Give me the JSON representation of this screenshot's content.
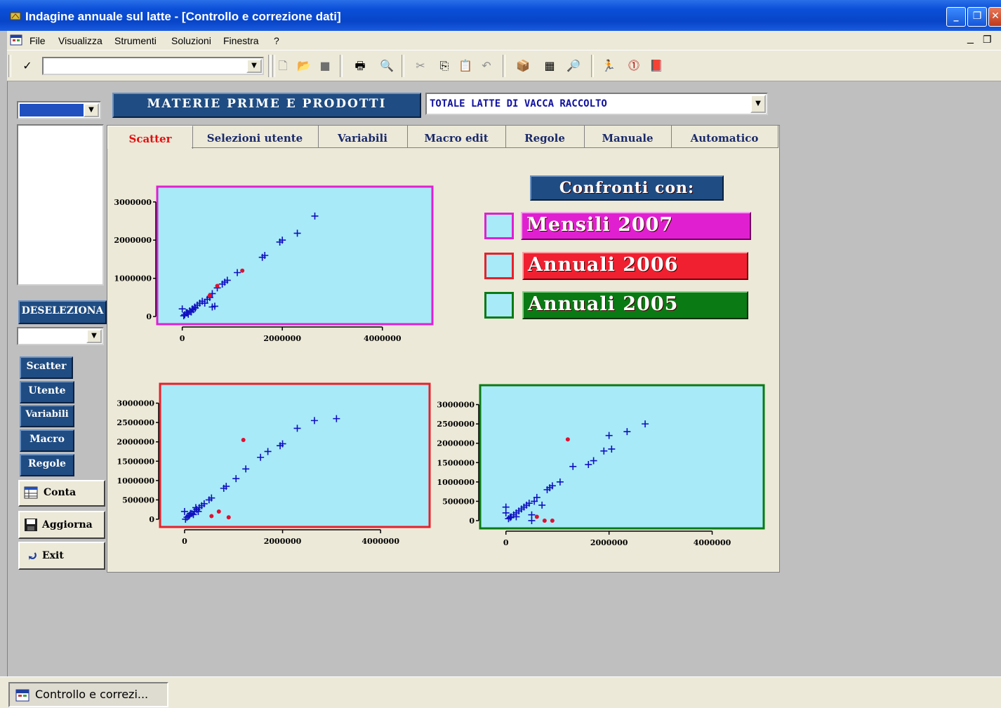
{
  "window": {
    "title": "Indagine annuale sul latte - [Controllo e correzione dati]"
  },
  "menu": [
    "File",
    "Visualizza",
    "Strumenti",
    "Soluzioni",
    "Finestra",
    "?"
  ],
  "header": {
    "section_label": "MATERIE PRIME E PRODOTTI",
    "variable_select": "TOTALE LATTE DI VACCA RACCOLTO"
  },
  "tabs": [
    "Scatter",
    "Selezioni utente",
    "Variabili",
    "Macro edit",
    "Regole",
    "Manuale",
    "Automatico"
  ],
  "left_panel": {
    "deselect_label": "DESELEZIONA",
    "nav_buttons": [
      "Scatter",
      "Utente",
      "Variabili",
      "Macro",
      "Regole"
    ],
    "conta_label": "Conta",
    "aggiorna_label": "Aggiorna",
    "exit_label": "Exit"
  },
  "legend": {
    "title": "Confronti con:",
    "items": [
      {
        "label": "Mensili 2007",
        "color": "#e020d0"
      },
      {
        "label": "Annuali 2006",
        "color": "#e8202a"
      },
      {
        "label": "Annuali 2005",
        "color": "#0a7a14"
      }
    ]
  },
  "taskbar": {
    "item": "Controllo e correzi..."
  },
  "colors": {
    "plot_bg": "#a8eaf8",
    "points": "#1010c0",
    "outliers": "#e01030"
  },
  "chart_data": [
    {
      "type": "scatter",
      "comparison": "Mensili 2007",
      "border_color": "#e020d0",
      "xlim": [
        -500000,
        5000000
      ],
      "ylim": [
        -200000,
        3400000
      ],
      "x_ticks": [
        0,
        2000000,
        4000000
      ],
      "y_ticks": [
        0,
        1000000,
        2000000,
        3000000
      ],
      "x_tick_labels": [
        "0",
        "2000000",
        "4000000"
      ],
      "y_tick_labels": [
        "0",
        "1000000",
        "2000000",
        "3000000"
      ],
      "series": [
        {
          "marker": "cross",
          "color": "#1010c0",
          "points": [
            [
              2650000,
              2630000
            ],
            [
              2300000,
              2180000
            ],
            [
              2000000,
              2000000
            ],
            [
              1950000,
              1950000
            ],
            [
              1650000,
              1600000
            ],
            [
              1600000,
              1550000
            ],
            [
              1100000,
              1150000
            ],
            [
              900000,
              950000
            ],
            [
              850000,
              900000
            ],
            [
              800000,
              850000
            ],
            [
              700000,
              750000
            ],
            [
              600000,
              600000
            ],
            [
              550000,
              500000
            ],
            [
              500000,
              450000
            ],
            [
              400000,
              400000
            ],
            [
              350000,
              350000
            ],
            [
              300000,
              300000
            ],
            [
              250000,
              250000
            ],
            [
              200000,
              200000
            ],
            [
              150000,
              150000
            ],
            [
              100000,
              100000
            ],
            [
              50000,
              50000
            ],
            [
              30000,
              20000
            ],
            [
              0,
              200000
            ],
            [
              80000,
              100000
            ],
            [
              120000,
              60000
            ],
            [
              180000,
              120000
            ],
            [
              220000,
              180000
            ],
            [
              260000,
              220000
            ],
            [
              450000,
              350000
            ],
            [
              600000,
              250000
            ],
            [
              650000,
              270000
            ]
          ]
        },
        {
          "marker": "dot",
          "color": "#e01030",
          "points": [
            [
              1200000,
              1200000
            ],
            [
              700000,
              800000
            ],
            [
              550000,
              550000
            ]
          ]
        }
      ]
    },
    {
      "type": "scatter",
      "comparison": "Annuali 2006",
      "border_color": "#e8202a",
      "xlim": [
        -500000,
        5000000
      ],
      "ylim": [
        -200000,
        3500000
      ],
      "x_ticks": [
        0,
        2000000,
        4000000
      ],
      "y_ticks": [
        0,
        500000,
        1000000,
        1500000,
        2000000,
        2500000,
        3000000
      ],
      "x_tick_labels": [
        "0",
        "2000000",
        "4000000"
      ],
      "y_tick_labels": [
        "0",
        "500000",
        "1000000",
        "1500000",
        "2000000",
        "2500000",
        "3000000"
      ],
      "series": [
        {
          "marker": "cross",
          "color": "#1010c0",
          "points": [
            [
              3100000,
              2600000
            ],
            [
              2650000,
              2550000
            ],
            [
              2300000,
              2350000
            ],
            [
              2000000,
              1950000
            ],
            [
              1950000,
              1900000
            ],
            [
              1700000,
              1750000
            ],
            [
              1550000,
              1600000
            ],
            [
              1250000,
              1300000
            ],
            [
              1050000,
              1050000
            ],
            [
              850000,
              850000
            ],
            [
              800000,
              800000
            ],
            [
              550000,
              550000
            ],
            [
              500000,
              500000
            ],
            [
              400000,
              400000
            ],
            [
              350000,
              350000
            ],
            [
              300000,
              300000
            ],
            [
              250000,
              250000
            ],
            [
              200000,
              200000
            ],
            [
              150000,
              150000
            ],
            [
              100000,
              100000
            ],
            [
              50000,
              50000
            ],
            [
              20000,
              0
            ],
            [
              0,
              200000
            ],
            [
              80000,
              80000
            ],
            [
              120000,
              150000
            ],
            [
              180000,
              120000
            ],
            [
              230000,
              300000
            ],
            [
              280000,
              200000
            ]
          ]
        },
        {
          "marker": "dot",
          "color": "#e01030",
          "points": [
            [
              1200000,
              2050000
            ],
            [
              700000,
              200000
            ],
            [
              900000,
              50000
            ],
            [
              550000,
              80000
            ]
          ]
        }
      ]
    },
    {
      "type": "scatter",
      "comparison": "Annuali 2005",
      "border_color": "#0a7a14",
      "xlim": [
        -500000,
        5000000
      ],
      "ylim": [
        -200000,
        3500000
      ],
      "x_ticks": [
        0,
        2000000,
        4000000
      ],
      "y_ticks": [
        0,
        500000,
        1000000,
        1500000,
        2000000,
        2500000,
        3000000
      ],
      "x_tick_labels": [
        "0",
        "2000000",
        "4000000"
      ],
      "y_tick_labels": [
        "0",
        "500000",
        "1000000",
        "1500000",
        "2000000",
        "2500000",
        "3000000"
      ],
      "series": [
        {
          "marker": "cross",
          "color": "#1010c0",
          "points": [
            [
              2700000,
              2500000
            ],
            [
              2350000,
              2300000
            ],
            [
              2000000,
              2200000
            ],
            [
              2050000,
              1850000
            ],
            [
              1900000,
              1800000
            ],
            [
              1700000,
              1550000
            ],
            [
              1600000,
              1450000
            ],
            [
              1300000,
              1400000
            ],
            [
              1050000,
              1000000
            ],
            [
              900000,
              900000
            ],
            [
              850000,
              850000
            ],
            [
              800000,
              800000
            ],
            [
              600000,
              600000
            ],
            [
              550000,
              500000
            ],
            [
              450000,
              450000
            ],
            [
              400000,
              400000
            ],
            [
              350000,
              350000
            ],
            [
              300000,
              300000
            ],
            [
              250000,
              250000
            ],
            [
              200000,
              200000
            ],
            [
              150000,
              150000
            ],
            [
              100000,
              100000
            ],
            [
              50000,
              50000
            ],
            [
              0,
              350000
            ],
            [
              0,
              200000
            ],
            [
              80000,
              80000
            ],
            [
              200000,
              100000
            ],
            [
              500000,
              150000
            ],
            [
              700000,
              400000
            ],
            [
              500000,
              0
            ]
          ]
        },
        {
          "marker": "dot",
          "color": "#e01030",
          "points": [
            [
              1200000,
              2100000
            ],
            [
              600000,
              100000
            ],
            [
              750000,
              0
            ],
            [
              900000,
              0
            ]
          ]
        }
      ]
    }
  ]
}
